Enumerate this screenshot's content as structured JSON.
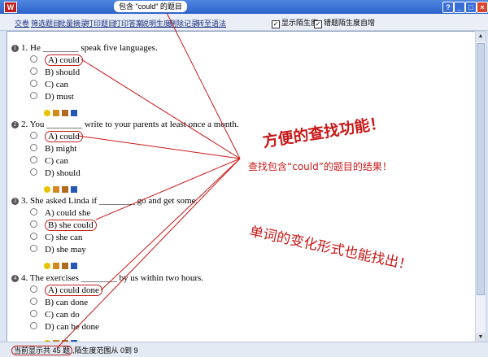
{
  "window": {
    "title": "包含 \"could\" 的题目",
    "app_icon_glyph": "W",
    "buttons": [
      "?",
      "_",
      "□",
      "×"
    ]
  },
  "toolbar": {
    "links": [
      "交卷",
      "筛选题目",
      "批量摘录",
      "打印题目",
      "打印答案",
      "说明生度",
      "删除记录",
      "转至语法"
    ],
    "checkboxes": [
      {
        "label": "显示陌生度",
        "checked": true
      },
      {
        "label": "错题陌生度自增",
        "checked": true
      }
    ]
  },
  "questions": [
    {
      "number": "1",
      "stem": "1. He ________ speak five languages.",
      "options": [
        "A) could",
        "B) should",
        "C) can",
        "D) must"
      ]
    },
    {
      "number": "2",
      "stem": "2. You ________ write to your parents at least once a month.",
      "options": [
        "A) could",
        "B) might",
        "C) can",
        "D) should"
      ]
    },
    {
      "number": "3",
      "stem": "3. She asked Linda if ________ go and get some.",
      "options": [
        "A) could she",
        "B) she could",
        "C) she can",
        "D) she may"
      ]
    },
    {
      "number": "4",
      "stem": "4. The exercises ________ by us within two hours.",
      "options": [
        "A) could done",
        "B) can done",
        "C) can do",
        "D) can be done"
      ]
    }
  ],
  "status": {
    "count_text": "当前显示共 45 题",
    "range_text": "陌生度范围从 0到 9"
  },
  "annotations": {
    "headline": "方便的查找功能！",
    "result_note": "查找包含“could”的题目的结果！",
    "variant_note": "单词的变化形式也能找出！"
  },
  "colors": {
    "accent_red": "#c81818",
    "titlebar_blue": "#2c63c9",
    "link_blue": "#1c2f7d"
  }
}
